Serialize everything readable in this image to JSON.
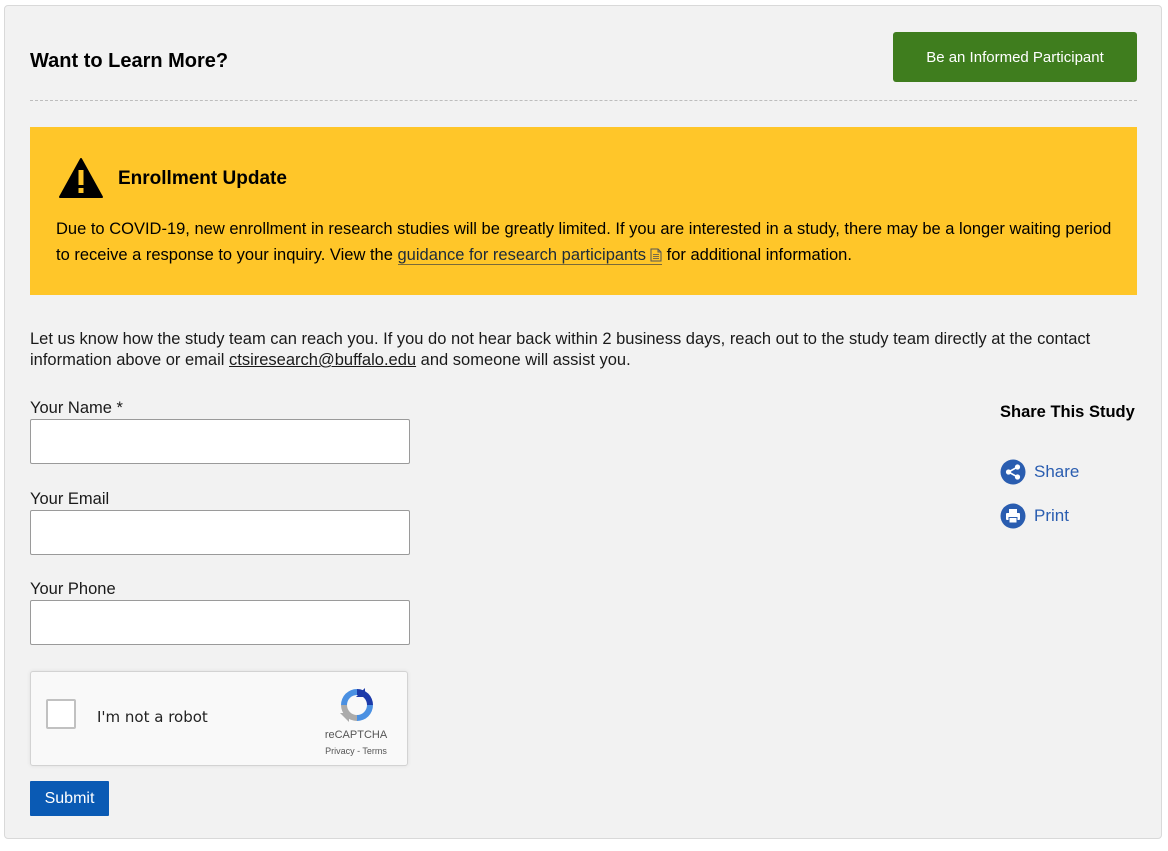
{
  "header": {
    "title": "Want to Learn More?",
    "cta_label": "Be an Informed Participant"
  },
  "alert": {
    "title": "Enrollment Update",
    "body_before": "Due to COVID-19, new enrollment in research studies will be greatly limited. If you are interested in a study, there may be a longer waiting period to receive a response to your inquiry. View the ",
    "link_text": "guidance for research participants",
    "body_after": " for additional information.",
    "icon": "warning-icon",
    "background": "#ffc629"
  },
  "intro": {
    "before": "Let us know how the study team can reach you. If you do not hear back within 2 business days, reach out to the study team directly at the contact information above or email ",
    "email": "ctsiresearch@buffalo.edu",
    "after": " and someone will assist you."
  },
  "form": {
    "name_label": "Your Name *",
    "email_label": "Your Email",
    "phone_label": "Your Phone",
    "submit_label": "Submit"
  },
  "captcha": {
    "label": "I'm not a robot",
    "brand": "reCAPTCHA",
    "links": "Privacy - Terms"
  },
  "share": {
    "title": "Share This Study",
    "share_label": "Share",
    "print_label": "Print",
    "link_color": "#2a5db0"
  },
  "colors": {
    "accent_green": "#3f7d1e",
    "submit_blue": "#0a5ab4",
    "panel_bg": "#f2f2f2"
  }
}
